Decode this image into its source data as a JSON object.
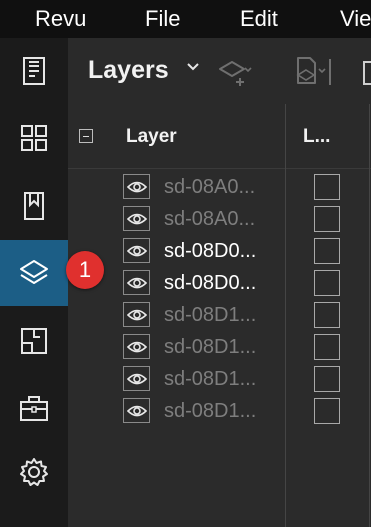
{
  "menubar": {
    "items": [
      "Revu",
      "File",
      "Edit",
      "Vie"
    ]
  },
  "sidebar": {
    "items": [
      {
        "icon": "document-icon",
        "active": false
      },
      {
        "icon": "thumbnails-grid-icon",
        "active": false
      },
      {
        "icon": "bookmark-icon",
        "active": false
      },
      {
        "icon": "layers-icon",
        "active": true
      },
      {
        "icon": "spaces-icon",
        "active": false
      },
      {
        "icon": "toolbox-icon",
        "active": false
      },
      {
        "icon": "gear-icon",
        "active": false
      }
    ],
    "badge": "1"
  },
  "panel": {
    "title": "Layers"
  },
  "columns": {
    "layer": "Layer",
    "lock": "L..."
  },
  "rows": [
    {
      "label": "sd-08A0...",
      "visible": false
    },
    {
      "label": "sd-08A0...",
      "visible": false
    },
    {
      "label": "sd-08D0...",
      "visible": true
    },
    {
      "label": "sd-08D0...",
      "visible": true
    },
    {
      "label": "sd-08D1...",
      "visible": false
    },
    {
      "label": "sd-08D1...",
      "visible": false
    },
    {
      "label": "sd-08D1...",
      "visible": false
    },
    {
      "label": "sd-08D1...",
      "visible": false
    }
  ],
  "colors": {
    "accent": "#1c5e86",
    "badge": "#e0302e",
    "dim_text": "#7e7e7e"
  }
}
